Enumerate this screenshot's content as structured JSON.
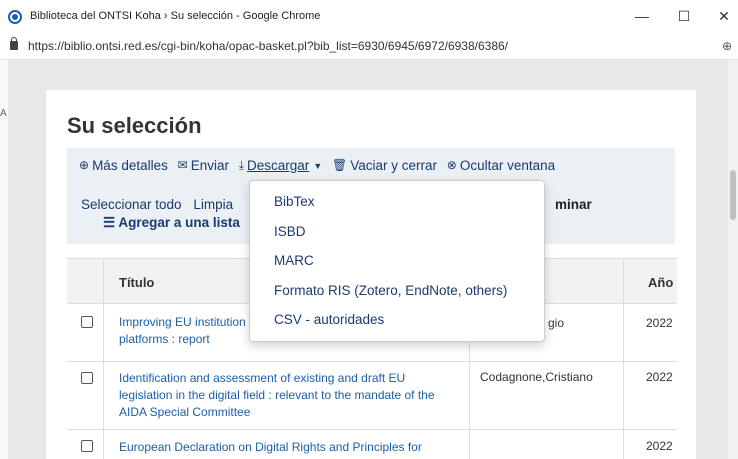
{
  "window": {
    "title": "Biblioteca del ONTSI Koha › Su selección - Google Chrome",
    "url": "https://biblio.ontsi.red.es/cgi-bin/koha/opac-basket.pl?bib_list=6930/6945/6972/6938/6386/",
    "minimize": "—",
    "maximize": "☐",
    "close": "✕"
  },
  "page": {
    "title": "Su selección"
  },
  "toolbar": {
    "mas_detalles": "Más detalles",
    "enviar": "Enviar",
    "descargar": "Descargar",
    "vaciar": "Vaciar y cerrar",
    "ocultar": "Ocultar ventana",
    "seleccionar_todo": "Seleccionar todo",
    "limpiar": "Limpia",
    "eliminar": "minar",
    "agregar_lista": "Agregar a una lista"
  },
  "dropdown": {
    "items": [
      "BibTex",
      "ISBD",
      "MARC",
      "Formato RIS (Zotero, EndNote, others)",
      "CSV - autoridades"
    ]
  },
  "table": {
    "headers": {
      "titulo": "Título",
      "anio": "Año"
    },
    "rows": [
      {
        "title_line1": "Improving EU institution",
        "title_line2": "platforms : report",
        "author": "gio",
        "year": "2022"
      },
      {
        "title_line1": "Identification and assessment of existing and draft EU",
        "title_line2": "legislation in the digital field : relevant to the mandate of the",
        "title_line3": "AIDA Special Committee",
        "author": "Codagnone,Cristiano",
        "year": "2022"
      },
      {
        "title_line1": "European Declaration on Digital Rights and Principles for",
        "year": "2022"
      }
    ]
  },
  "colors": {
    "link": "#1c5fa8",
    "toolbar_bg": "#eaf0f3",
    "nav": "#1c3a6e"
  }
}
